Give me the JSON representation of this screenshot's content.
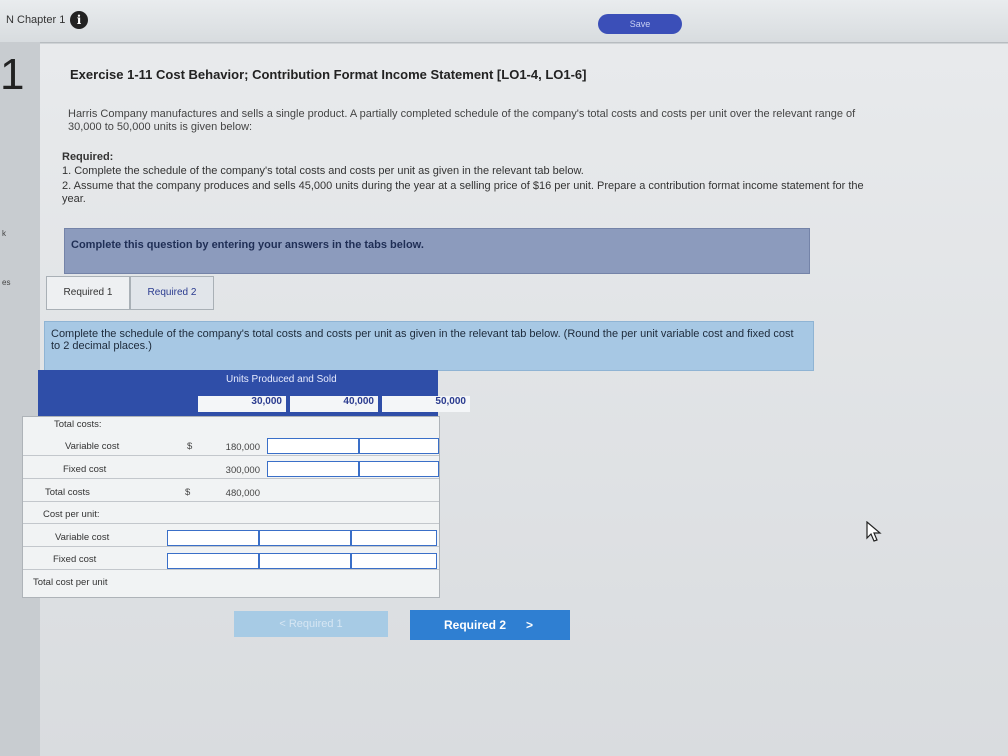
{
  "header": {
    "chapter_label": "N Chapter 1",
    "info_glyph": "i",
    "save_label": "Save"
  },
  "sidebar": {
    "question_number": "1",
    "labels": [
      "k",
      "es"
    ]
  },
  "exercise": {
    "title": "Exercise 1-11 Cost Behavior; Contribution Format Income Statement [LO1-4, LO1-6]",
    "intro": "Harris Company manufactures and sells a single product. A partially completed schedule of the company's total costs and costs per unit over the relevant range of 30,000 to 50,000 units is given below:",
    "required_heading": "Required:",
    "required_items": [
      "1. Complete the schedule of the company's total costs and costs per unit as given in the relevant tab below.",
      "2. Assume that the company produces and sells 45,000 units during the year at a selling price of $16 per unit. Prepare a contribution format income statement for the year."
    ]
  },
  "instruction_bar": "Complete this question by entering your answers in the tabs below.",
  "tabs": [
    "Required 1",
    "Required 2"
  ],
  "panel_instruction": "Complete the schedule of the company's total costs and costs per unit as given in the relevant tab below. (Round the per unit variable cost and fixed cost to 2 decimal places.)",
  "schedule": {
    "header_title": "Units Produced and Sold",
    "columns": [
      "30,000",
      "40,000",
      "50,000"
    ],
    "rows": {
      "total_costs_label": "Total costs:",
      "variable_cost_label": "Variable cost",
      "fixed_cost_label": "Fixed cost",
      "total_costs_sum_label": "Total costs",
      "cost_per_unit_label": "Cost per unit:",
      "unit_variable_label": "Variable cost",
      "unit_fixed_label": "Fixed cost",
      "total_cost_per_unit_label": "Total cost per unit"
    },
    "currency_symbol": "$",
    "given": {
      "variable_30000": "180,000",
      "fixed_30000": "300,000",
      "total_30000": "480,000"
    }
  },
  "navigation": {
    "prev_label": "< Required 1",
    "next_label": "Required 2",
    "next_chevron": ">"
  },
  "colors": {
    "header_blue": "#2f4ea8",
    "instruction_bar": "#8c9bbd",
    "panel_blue": "#a7c8e4",
    "next_button": "#2f7fd2"
  }
}
